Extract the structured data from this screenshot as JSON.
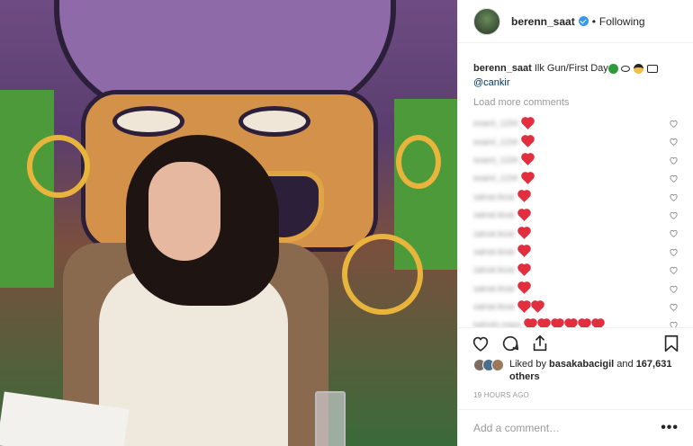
{
  "post": {
    "username": "berenn_saat",
    "separator": "•",
    "follow_status": "Following"
  },
  "caption": {
    "username": "berenn_saat",
    "text": "Ilk Gun/First Day",
    "mention": "@cankir"
  },
  "comments": {
    "load_more": "Load more comments",
    "rows": [
      {
        "user": "eoaml_1234",
        "hearts": 1
      },
      {
        "user": "eoaml_1234",
        "hearts": 1
      },
      {
        "user": "eoaml_1234",
        "hearts": 1
      },
      {
        "user": "eoaml_1234",
        "hearts": 1
      },
      {
        "user": "satnat.ikoal",
        "hearts": 1
      },
      {
        "user": "satnat.ikoal",
        "hearts": 1
      },
      {
        "user": "satnat.ikoal",
        "hearts": 1
      },
      {
        "user": "satnat.ikoal",
        "hearts": 1
      },
      {
        "user": "satnat.ikoal",
        "hearts": 1
      },
      {
        "user": "satnat.ikoal",
        "hearts": 1
      },
      {
        "user": "satnat.ikoal",
        "hearts": 2
      },
      {
        "user": "kahvdz.mayo",
        "hearts": 6
      }
    ]
  },
  "likes": {
    "prefix": "Liked by",
    "user": "basakabacigil",
    "conj": "and",
    "others": "167,631 others"
  },
  "timestamp": "19 HOURS AGO",
  "add_comment": {
    "placeholder": "Add a comment…",
    "more": "•••"
  },
  "colors": {
    "verified": "#3897f0",
    "heart_red": "#e22f3f",
    "link": "#003569",
    "muted": "#999999"
  },
  "icons": [
    "verified-badge-icon",
    "heart-icon",
    "comment-icon",
    "share-icon",
    "bookmark-icon",
    "more-options-icon"
  ]
}
